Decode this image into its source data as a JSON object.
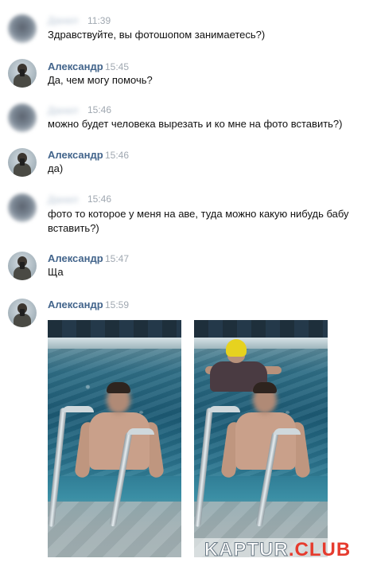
{
  "messages": [
    {
      "sender": "Данил",
      "sender_blurred": true,
      "time": "11:39",
      "text": "Здравствуйте, вы фотошопом занимаетесь?)"
    },
    {
      "sender": "Александр",
      "sender_blurred": false,
      "time": "15:45",
      "text": "Да, чем могу помочь?"
    },
    {
      "sender": "Данил",
      "sender_blurred": true,
      "time": "15:46",
      "text": "можно будет человека вырезать и ко мне на фото вставить?)"
    },
    {
      "sender": "Александр",
      "sender_blurred": false,
      "time": "15:46",
      "text": "да)"
    },
    {
      "sender": "Данил",
      "sender_blurred": true,
      "time": "15:46",
      "text_line1": "фото то которое у меня на аве, туда можно какую нибудь бабу",
      "text_line2": "вставить?)"
    },
    {
      "sender": "Александр",
      "sender_blurred": false,
      "time": "15:47",
      "text": "Ща"
    },
    {
      "sender": "Александр",
      "sender_blurred": false,
      "time": "15:59",
      "attachments": [
        "pool-photo-original",
        "pool-photo-edited"
      ]
    }
  ],
  "watermark": {
    "part1": "KAPTUR",
    "part2": ".CLUB"
  },
  "colors": {
    "sender_name": "#42648b",
    "timestamp": "#a0a8b1",
    "message_text": "#111111",
    "watermark_accent": "#e63b2e"
  },
  "icons": {
    "avatar_blurred": "blurred-avatar",
    "avatar_alexander": "avatar-photo"
  }
}
